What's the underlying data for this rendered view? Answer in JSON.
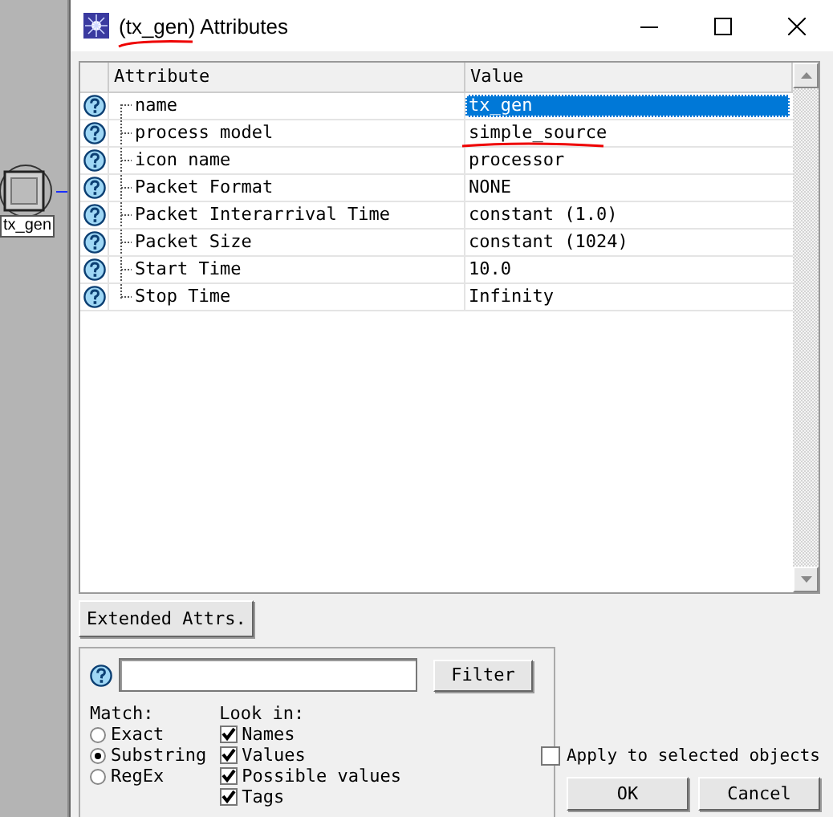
{
  "canvas": {
    "node_label": "tx_gen"
  },
  "window": {
    "title": "(tx_gen) Attributes"
  },
  "table": {
    "columns": [
      "Attribute",
      "Value"
    ],
    "rows": [
      {
        "attribute": "name",
        "value": "tx_gen",
        "selected": true
      },
      {
        "attribute": "process model",
        "value": "simple_source",
        "selected": false
      },
      {
        "attribute": "icon name",
        "value": "processor",
        "selected": false
      },
      {
        "attribute": "Packet Format",
        "value": "NONE",
        "selected": false
      },
      {
        "attribute": "Packet Interarrival Time",
        "value": "constant (1.0)",
        "selected": false
      },
      {
        "attribute": "Packet Size",
        "value": "constant (1024)",
        "selected": false
      },
      {
        "attribute": "Start Time",
        "value": "10.0",
        "selected": false
      },
      {
        "attribute": "Stop Time",
        "value": "Infinity",
        "selected": false
      }
    ]
  },
  "extended_button": "Extended Attrs.",
  "filter": {
    "button": "Filter",
    "match": {
      "label": "Match:",
      "options": [
        {
          "label": "Exact",
          "selected": false
        },
        {
          "label": "Substring",
          "selected": true
        },
        {
          "label": "RegEx",
          "selected": false
        }
      ]
    },
    "look_in": {
      "label": "Look in:",
      "options": [
        {
          "label": "Names",
          "checked": true
        },
        {
          "label": "Values",
          "checked": true
        },
        {
          "label": "Possible values",
          "checked": true
        },
        {
          "label": "Tags",
          "checked": true
        }
      ]
    }
  },
  "apply_selected": {
    "label": "Apply to selected objects",
    "checked": false
  },
  "buttons": [
    "OK",
    "Cancel"
  ]
}
